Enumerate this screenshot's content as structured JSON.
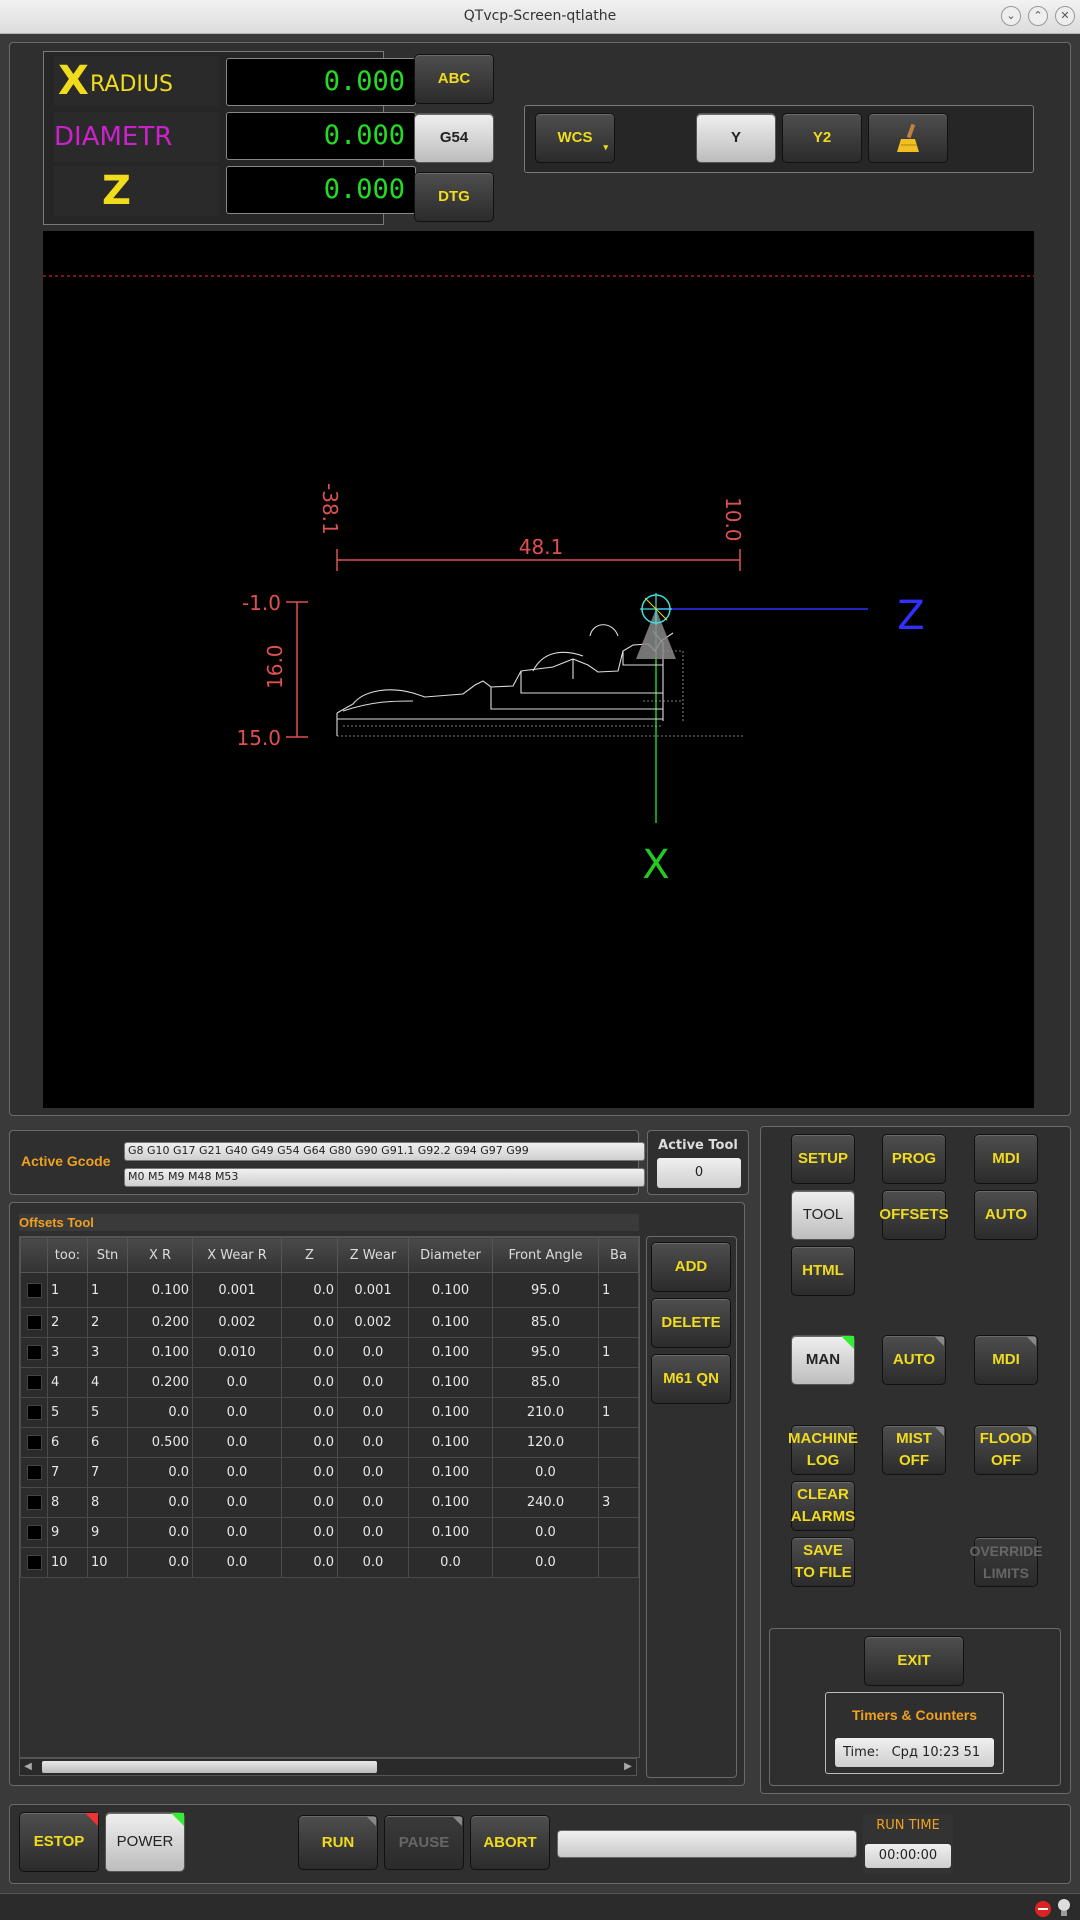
{
  "window": {
    "title": "QTvcp-Screen-qtlathe"
  },
  "dro": {
    "rows": [
      {
        "axis": "X",
        "sub": "RADIUS",
        "value": "0.000"
      },
      {
        "axis": "",
        "sub": "DIAMETR",
        "value": "0.000"
      },
      {
        "axis": "Z",
        "sub": "",
        "value": "0.000"
      }
    ]
  },
  "ref_buttons": {
    "abc": "ABC",
    "g54": "G54",
    "dtg": "DTG"
  },
  "wcs_bar": {
    "wcs": "WCS",
    "y": "Y",
    "y2": "Y2"
  },
  "preview": {
    "dim_top_left": "-38.1",
    "dim_top_right": "10.0",
    "dim_width": "48.1",
    "dim_left_top": "-1.0",
    "dim_left_height": "16.0",
    "dim_left_bottom": "15.0",
    "axis_z": "Z",
    "axis_x": "X",
    "colors": {
      "dim": "#e05050",
      "z_axis": "#3030ff",
      "x_axis": "#22cc22",
      "tool": "#40e0e0"
    }
  },
  "active_gcode": {
    "label": "Active Gcode",
    "gcodes": "G8 G10 G17 G21 G40 G49 G54 G64 G80 G90 G91.1 G92.2 G94 G97 G99",
    "mcodes": "M0 M5 M9 M48 M53"
  },
  "active_tool": {
    "label": "Active Tool",
    "value": "0"
  },
  "offsets": {
    "title": "Offsets Tool",
    "columns": [
      "too:",
      "Stn",
      "X R",
      "X Wear R",
      "Z",
      "Z Wear",
      "Diameter",
      "Front Angle",
      "Ba"
    ],
    "rows": [
      [
        "1",
        "1",
        "0.100",
        "0.001",
        "0.0",
        "0.001",
        "0.100",
        "95.0",
        "1"
      ],
      [
        "2",
        "2",
        "0.200",
        "0.002",
        "0.0",
        "0.002",
        "0.100",
        "85.0",
        ""
      ],
      [
        "3",
        "3",
        "0.100",
        "0.010",
        "0.0",
        "0.0",
        "0.100",
        "95.0",
        "1"
      ],
      [
        "4",
        "4",
        "0.200",
        "0.0",
        "0.0",
        "0.0",
        "0.100",
        "85.0",
        ""
      ],
      [
        "5",
        "5",
        "0.0",
        "0.0",
        "0.0",
        "0.0",
        "0.100",
        "210.0",
        "1"
      ],
      [
        "6",
        "6",
        "0.500",
        "0.0",
        "0.0",
        "0.0",
        "0.100",
        "120.0",
        ""
      ],
      [
        "7",
        "7",
        "0.0",
        "0.0",
        "0.0",
        "0.0",
        "0.100",
        "0.0",
        ""
      ],
      [
        "8",
        "8",
        "0.0",
        "0.0",
        "0.0",
        "0.0",
        "0.100",
        "240.0",
        "3"
      ],
      [
        "9",
        "9",
        "0.0",
        "0.0",
        "0.0",
        "0.0",
        "0.100",
        "0.0",
        ""
      ],
      [
        "10",
        "10",
        "0.0",
        "0.0",
        "0.0",
        "0.0",
        "0.0",
        "0.0",
        ""
      ]
    ],
    "buttons": {
      "add": "ADD",
      "delete": "DELETE",
      "m61": "M61 QN"
    }
  },
  "tabs": {
    "setup": "SETUP",
    "prog": "PROG",
    "mdi": "MDI",
    "tool": "TOOL",
    "offsets": "OFFSETS",
    "auto": "AUTO",
    "html": "HTML"
  },
  "modes": {
    "man": "MAN",
    "auto": "AUTO",
    "mdi": "MDI"
  },
  "actions": {
    "machine_log": [
      "MACHINE",
      "LOG"
    ],
    "mist": [
      "MIST",
      "OFF"
    ],
    "flood": [
      "FLOOD",
      "OFF"
    ],
    "clear_alarms": [
      "CLEAR",
      "ALARMS"
    ],
    "save_file": [
      "SAVE",
      "TO FILE"
    ],
    "override": [
      "OVERRIDE",
      "LIMITS"
    ]
  },
  "exit_label": "EXIT",
  "timers": {
    "title": "Timers & Counters",
    "time_label": "Time:",
    "time_value": "Срд 10:23 51"
  },
  "bottom": {
    "estop": "ESTOP",
    "power": "POWER",
    "run": "RUN",
    "pause": "PAUSE",
    "abort": "ABORT",
    "run_time_label": "RUN TIME",
    "run_time_value": "00:00:00"
  }
}
